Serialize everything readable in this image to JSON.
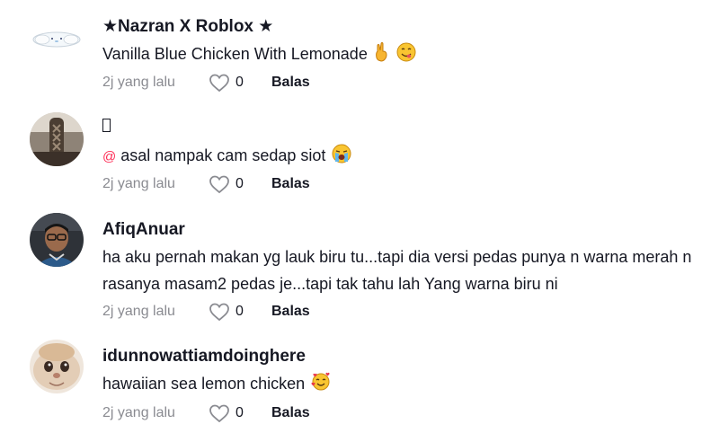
{
  "comments": [
    {
      "username": "★Nazran X Roblox ★",
      "text": "Vanilla Blue Chicken With Lemonade",
      "emojis": [
        "crossed-fingers-emoji",
        "face-savoring-food-emoji"
      ],
      "time": "2j yang lalu",
      "likes": "0",
      "reply": "Balas"
    },
    {
      "username": "👍",
      "mention": "@",
      "text": "asal nampak cam sedap siot",
      "emojis": [
        "loudly-crying-face-emoji"
      ],
      "time": "2j yang lalu",
      "likes": "0",
      "reply": "Balas"
    },
    {
      "username": "AfiqAnuar",
      "text": "ha aku pernah makan yg lauk biru tu...tapi dia versi pedas punya n warna merah n rasanya masam2 pedas je...tapi tak tahu lah Yang warna biru ni",
      "time": "2j yang lalu",
      "likes": "0",
      "reply": "Balas"
    },
    {
      "username": "idunnowattiamdoinghere",
      "text": "hawaiian sea lemon chicken",
      "emojis": [
        "smiling-face-with-hearts-emoji"
      ],
      "time": "2j yang lalu",
      "likes": "0",
      "reply": "Balas"
    }
  ],
  "colors": {
    "mention": "#fe2c55",
    "meta": "#8a8b91",
    "text": "#161823"
  }
}
